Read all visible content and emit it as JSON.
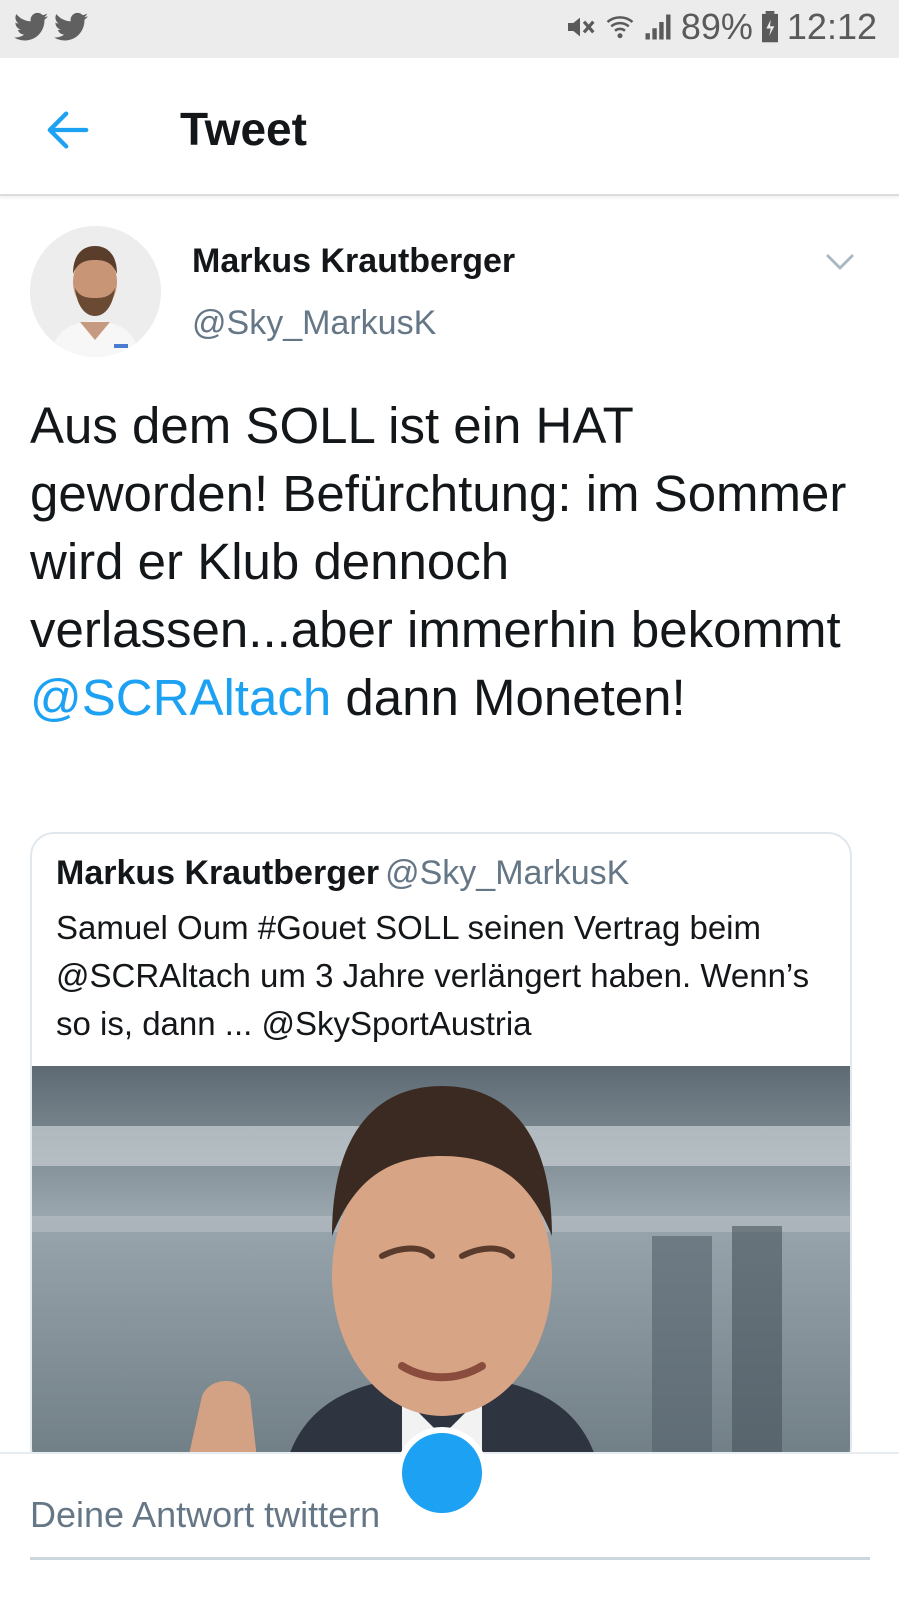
{
  "status_bar": {
    "battery": "89%",
    "time": "12:12",
    "icons": [
      "twitter-icon",
      "twitter-icon",
      "mute-icon",
      "wifi-icon",
      "signal-icon",
      "battery-icon"
    ]
  },
  "header": {
    "title": "Tweet",
    "back_icon": "arrow-left-icon"
  },
  "tweet": {
    "author_name": "Markus Krautberger",
    "author_handle": "@Sky_MarkusK",
    "text_part1": "Aus dem SOLL ist ein HAT geworden! Befürchtung: im Sommer wird er Klub dennoch verlassen...aber immerhin bekommt ",
    "mention": "@SCRAltach",
    "text_part2": " dann Moneten!"
  },
  "quoted_tweet": {
    "author_name": "Markus Krautberger",
    "author_handle": "@Sky_MarkusK",
    "text": "Samuel Oum #Gouet SOLL seinen Vertrag beim @SCRAltach um 3 Jahre verlängert haben. Wenn’s so is, dann ... @SkySportAustria"
  },
  "reply": {
    "placeholder": "Deine Antwort twittern"
  },
  "colors": {
    "accent": "#1da1f2",
    "secondary_text": "#657786",
    "primary_text": "#14171a"
  }
}
